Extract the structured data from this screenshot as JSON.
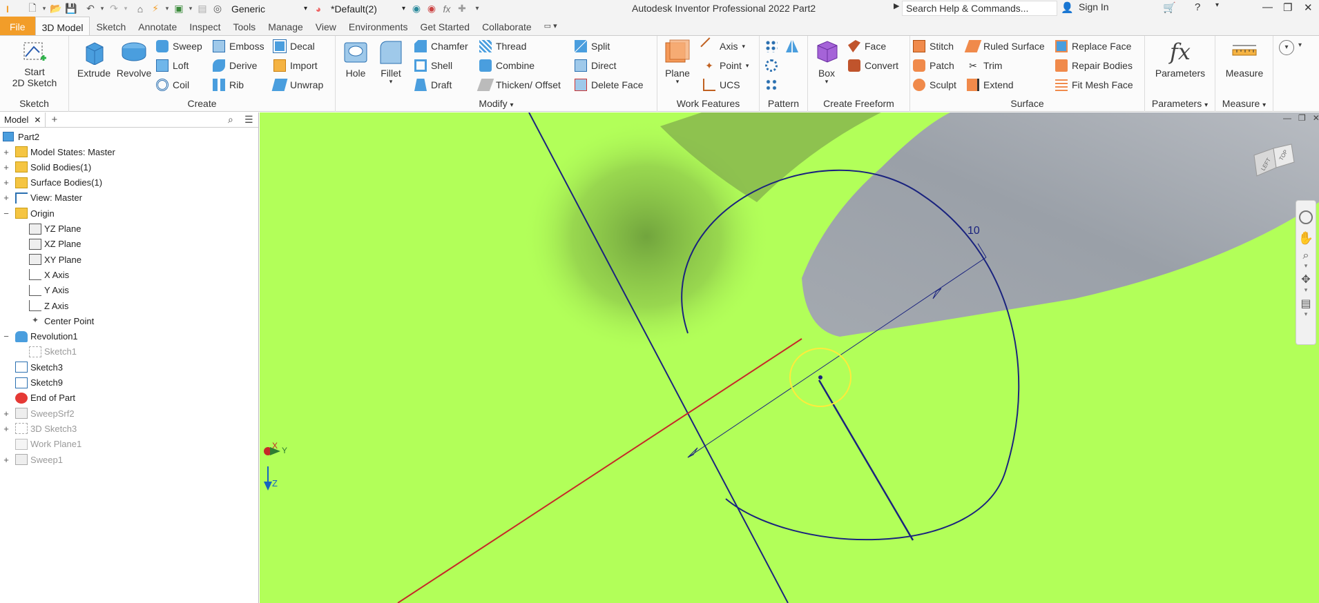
{
  "titlebar": {
    "app_title": "Autodesk Inventor Professional 2022   Part2",
    "material_combo": "Generic",
    "appearance_combo": "*Default(2)",
    "search_placeholder": "Search Help & Commands...",
    "sign_in": "Sign In"
  },
  "tabs": [
    "File",
    "3D Model",
    "Sketch",
    "Annotate",
    "Inspect",
    "Tools",
    "Manage",
    "View",
    "Environments",
    "Get Started",
    "Collaborate"
  ],
  "active_tab": "3D Model",
  "ribbon": {
    "sketch_panel": {
      "title": "Sketch",
      "start_label": "Start\n2D Sketch"
    },
    "create_panel": {
      "title": "Create",
      "extrude": "Extrude",
      "revolve": "Revolve",
      "sweep": "Sweep",
      "loft": "Loft",
      "coil": "Coil",
      "emboss": "Emboss",
      "derive": "Derive",
      "rib": "Rib",
      "decal": "Decal",
      "import": "Import",
      "unwrap": "Unwrap"
    },
    "modify_panel": {
      "title": "Modify",
      "hole": "Hole",
      "fillet": "Fillet",
      "chamfer": "Chamfer",
      "shell": "Shell",
      "draft": "Draft",
      "thread": "Thread",
      "combine": "Combine",
      "thicken": "Thicken/ Offset",
      "split": "Split",
      "direct": "Direct",
      "delete_face": "Delete Face"
    },
    "work_panel": {
      "title": "Work Features",
      "plane": "Plane",
      "axis": "Axis",
      "point": "Point",
      "ucs": "UCS"
    },
    "pattern_panel": {
      "title": "Pattern"
    },
    "freeform_panel": {
      "title": "Create Freeform",
      "box": "Box",
      "face": "Face",
      "convert": "Convert"
    },
    "surface_panel": {
      "title": "Surface",
      "stitch": "Stitch",
      "patch": "Patch",
      "sculpt": "Sculpt",
      "ruled": "Ruled Surface",
      "trim": "Trim",
      "extend": "Extend",
      "replace": "Replace Face",
      "repair": "Repair Bodies",
      "fitmesh": "Fit Mesh Face"
    },
    "parameters_panel": {
      "title": "Parameters",
      "label": "Parameters"
    },
    "measure_panel": {
      "title": "Measure",
      "label": "Measure"
    }
  },
  "browser": {
    "tab_label": "Model",
    "root": "Part2",
    "items": [
      {
        "label": "Model States: Master",
        "expander": "+",
        "icon": "folder"
      },
      {
        "label": "Solid Bodies(1)",
        "expander": "+",
        "icon": "folder"
      },
      {
        "label": "Surface Bodies(1)",
        "expander": "+",
        "icon": "folder"
      },
      {
        "label": "View: Master",
        "expander": "+",
        "icon": "view"
      },
      {
        "label": "Origin",
        "expander": "−",
        "icon": "folder"
      },
      {
        "label": "YZ Plane",
        "expander": "",
        "icon": "plane"
      },
      {
        "label": "XZ Plane",
        "expander": "",
        "icon": "plane"
      },
      {
        "label": "XY Plane",
        "expander": "",
        "icon": "plane"
      },
      {
        "label": "X Axis",
        "expander": "",
        "icon": "axis"
      },
      {
        "label": "Y Axis",
        "expander": "",
        "icon": "axis"
      },
      {
        "label": "Z Axis",
        "expander": "",
        "icon": "axis"
      },
      {
        "label": "Center Point",
        "expander": "",
        "icon": "point"
      },
      {
        "label": "Revolution1",
        "expander": "−",
        "icon": "revolve"
      },
      {
        "label": "Sketch1",
        "expander": "",
        "icon": "sketch-dim"
      },
      {
        "label": "Sketch3",
        "expander": "",
        "icon": "sketch"
      },
      {
        "label": "Sketch9",
        "expander": "",
        "icon": "sketch"
      },
      {
        "label": "End of Part",
        "expander": "",
        "icon": "end"
      },
      {
        "label": "SweepSrf2",
        "expander": "+",
        "icon": "sweep-dim"
      },
      {
        "label": "3D Sketch3",
        "expander": "+",
        "icon": "sketch-dim"
      },
      {
        "label": "Work Plane1",
        "expander": "",
        "icon": "plane-dim"
      },
      {
        "label": "Sweep1",
        "expander": "+",
        "icon": "sweep-dim"
      }
    ]
  },
  "viewport": {
    "dimension_value": "10",
    "viewcube_face": "LEFT",
    "viewcube_top": "TOP",
    "triad_x": "X",
    "triad_y": "Y",
    "triad_z": "Z",
    "background_color": "#b2ff59"
  }
}
